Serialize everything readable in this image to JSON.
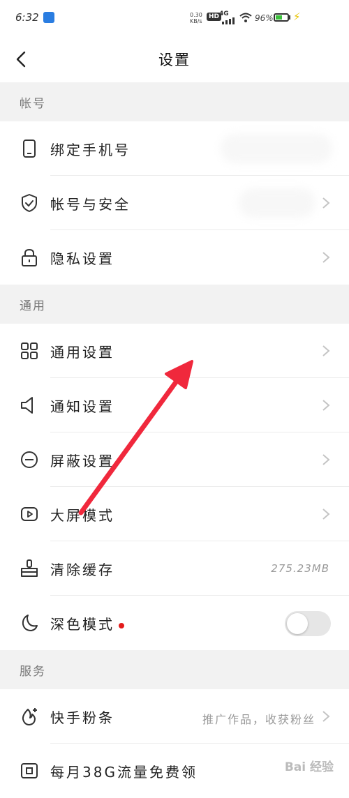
{
  "status_bar": {
    "time": "6:32",
    "speed_top": "0.30",
    "speed_bottom": "KB/s",
    "hd": "HD",
    "network": "4G",
    "battery": "96%"
  },
  "header": {
    "title": "设置"
  },
  "sections": {
    "account": "帐号",
    "general": "通用",
    "services": "服务"
  },
  "rows": {
    "bind_phone": "绑定手机号",
    "account_security": "帐号与安全",
    "privacy": "隐私设置",
    "general_settings": "通用设置",
    "notification": "通知设置",
    "block": "屏蔽设置",
    "big_screen": "大屏模式",
    "clear_cache": "清除缓存",
    "cache_size": "275.23MB",
    "dark_mode": "深色模式",
    "kuaishou_fans": "快手粉条",
    "kuaishou_fans_hint": "推广作品，收获粉丝",
    "monthly_data": "每月38G流量免费领"
  },
  "toggles": {
    "dark_mode_on": false
  },
  "colors": {
    "accent_red": "#e31b1b",
    "arrow_red": "#f0283c"
  },
  "watermark": "Bai 经验"
}
